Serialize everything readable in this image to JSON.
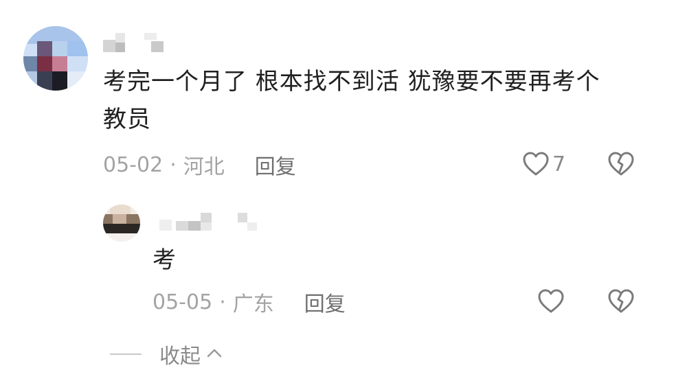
{
  "comments": [
    {
      "text": "考完一个月了 根本找不到活 犹豫要不要再考个\n教员",
      "date": "05-02",
      "separator": "·",
      "location": "河北",
      "reply_label": "回复",
      "likes": "7"
    }
  ],
  "replies": [
    {
      "text": "考",
      "date": "05-05",
      "separator": "·",
      "location": "广东",
      "reply_label": "回复"
    }
  ],
  "collapse_label": "收起",
  "icons": {
    "like": "heart-outline-icon",
    "dislike": "broken-heart-icon",
    "collapse": "chevron-up-icon"
  },
  "colors": {
    "text": "#1f1f1f",
    "meta": "#a3a3a3",
    "icon": "#7a7a7a"
  }
}
